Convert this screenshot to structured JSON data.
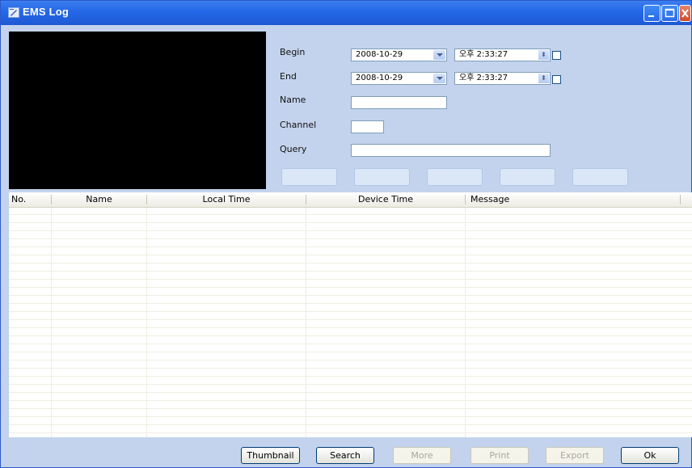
{
  "window": {
    "title": "EMS Log",
    "minimize_icon": "minimize-icon",
    "maximize_icon": "maximize-icon",
    "close_icon": "close-icon"
  },
  "filters": {
    "begin_label": "Begin",
    "begin_date": "2008-10-29",
    "begin_time": "오후  2:33:27",
    "end_label": "End",
    "end_date": "2008-10-29",
    "end_time": "오후  2:33:27",
    "name_label": "Name",
    "name_value": "",
    "channel_label": "Channel",
    "channel_value": "",
    "query_label": "Query",
    "query_value": ""
  },
  "table": {
    "columns": [
      "No.",
      "Name",
      "Local Time",
      "Device Time",
      "Message"
    ],
    "rows": []
  },
  "buttons": {
    "thumbnail": "Thumbnail",
    "search": "Search",
    "more": "More",
    "print": "Print",
    "export": "Export",
    "ok": "Ok"
  },
  "colors": {
    "titlebar": "#2467e6",
    "window_bg": "#c3d3ed",
    "preview_bg": "#000000"
  }
}
